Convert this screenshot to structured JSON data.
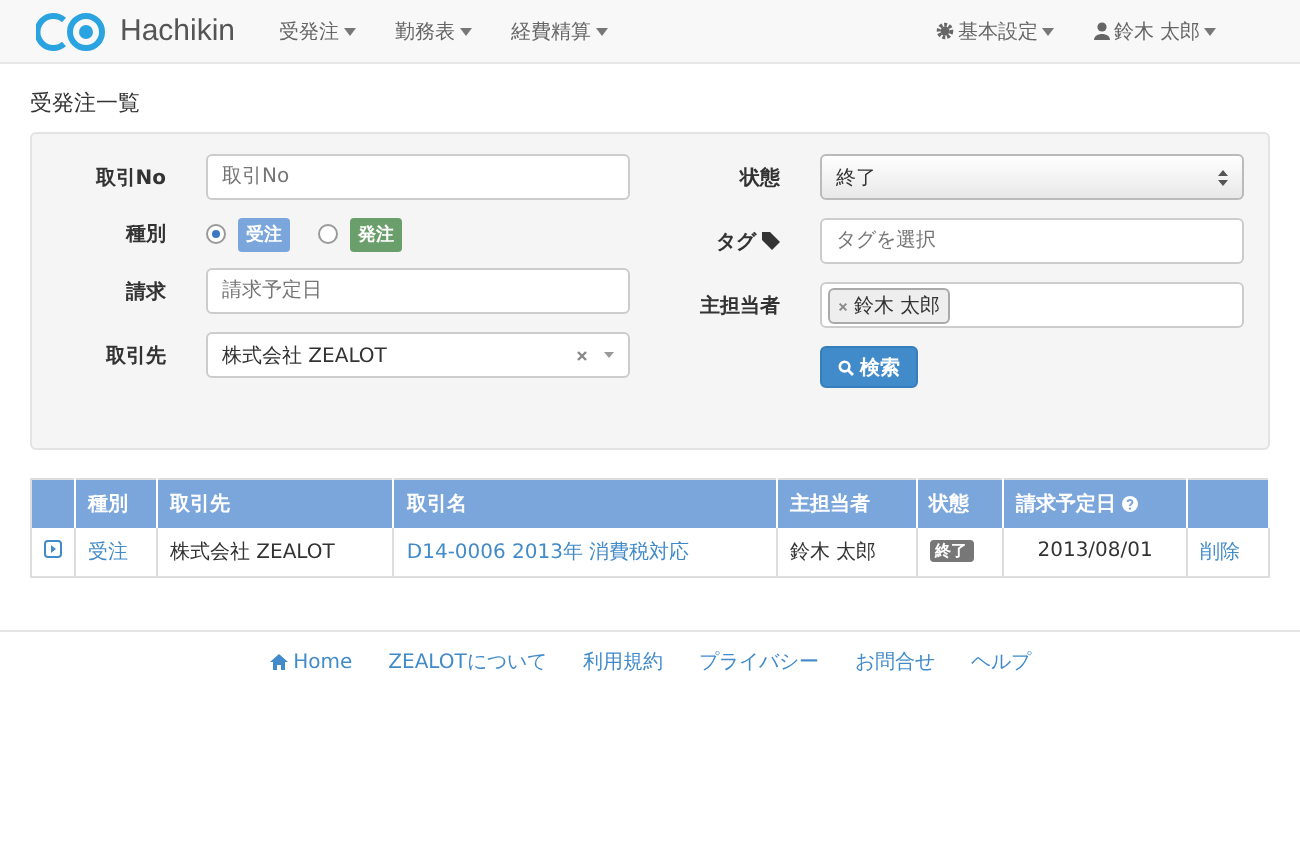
{
  "navbar": {
    "brand": "Hachikin",
    "menus": [
      {
        "label": "受発注"
      },
      {
        "label": "勤務表"
      },
      {
        "label": "経費精算"
      }
    ],
    "right_menus": [
      {
        "kind": "settings",
        "label": "基本設定"
      },
      {
        "kind": "user",
        "label": "鈴木 太郎"
      }
    ]
  },
  "page_title": "受発注一覧",
  "search": {
    "left": [
      {
        "kind": "text",
        "label": "取引No",
        "placeholder": "取引No"
      },
      {
        "kind": "radio",
        "label": "種別",
        "options": [
          {
            "label": "受注",
            "selected": true,
            "color": "#7ba6dc"
          },
          {
            "label": "発注",
            "selected": false,
            "color": "#6a9e6a"
          }
        ]
      },
      {
        "kind": "text",
        "label": "請求",
        "placeholder": "請求予定日"
      },
      {
        "kind": "combo",
        "label": "取引先",
        "value": "株式会社 ZEALOT"
      }
    ],
    "right": [
      {
        "kind": "select",
        "label": "状態",
        "value": "終了"
      },
      {
        "kind": "text",
        "label": "タグ",
        "tag_icon": true,
        "placeholder": "タグを選択"
      },
      {
        "kind": "tags",
        "label": "主担当者",
        "tags": [
          "鈴木 太郎"
        ]
      }
    ],
    "button": "検索"
  },
  "table": {
    "columns": [
      {
        "label": "種別"
      },
      {
        "label": "取引先"
      },
      {
        "label": "取引名"
      },
      {
        "label": "主担当者"
      },
      {
        "label": "状態"
      },
      {
        "label": "請求予定日",
        "help": true
      }
    ],
    "rows": [
      {
        "type": "受注",
        "partner": "株式会社 ZEALOT",
        "name": "D14-0006 2013年 消費税対応",
        "owner": "鈴木 太郎",
        "status": "終了",
        "date": "2013/08/01",
        "action": "削除"
      }
    ]
  },
  "footer": [
    {
      "label": "Home",
      "kind": "home"
    },
    {
      "label": "ZEALOTについて"
    },
    {
      "label": "利用規約"
    },
    {
      "label": "プライバシー"
    },
    {
      "label": "お問合せ"
    },
    {
      "label": "ヘルプ"
    }
  ]
}
